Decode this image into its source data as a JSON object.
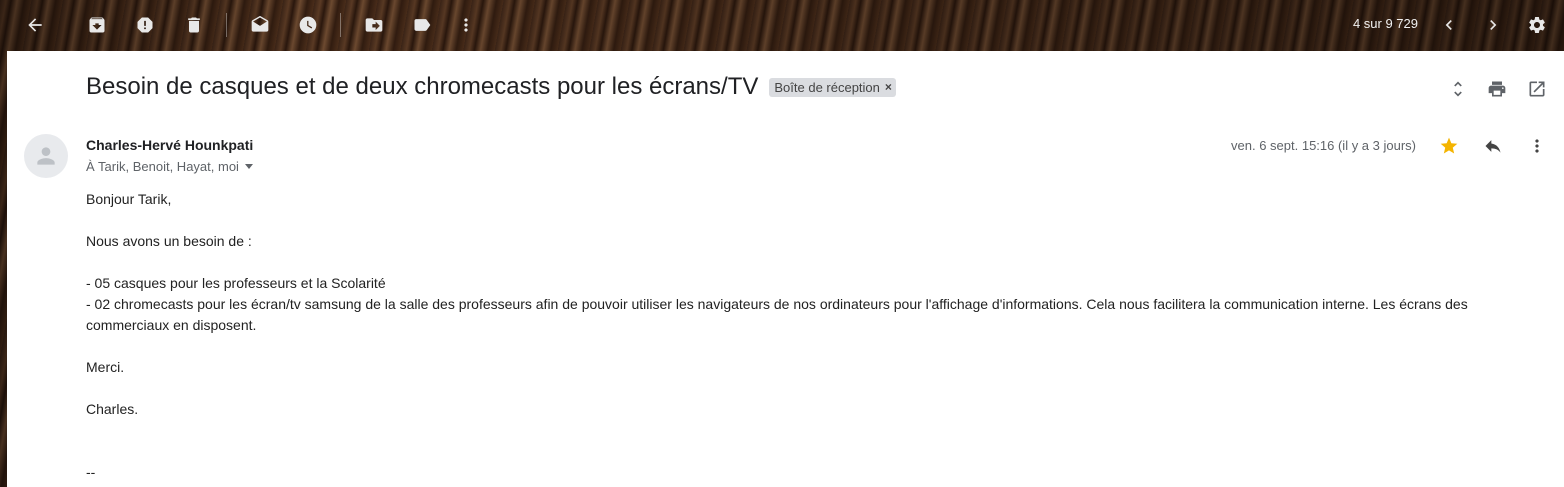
{
  "toolbar": {
    "buttons": [
      {
        "name": "back-icon"
      },
      {
        "name": "archive-icon"
      },
      {
        "name": "report-spam-icon"
      },
      {
        "name": "delete-icon"
      },
      {
        "name": "mark-unread-icon"
      },
      {
        "name": "snooze-icon"
      },
      {
        "name": "move-to-icon"
      },
      {
        "name": "label-icon"
      },
      {
        "name": "more-vert-icon"
      }
    ],
    "counter": "4 sur 9 729"
  },
  "email": {
    "subject": "Besoin de casques et de deux chromecasts pour les écrans/TV",
    "label_chip": "Boîte de réception",
    "label_chip_close": "×",
    "sender": "Charles-Hervé Hounkpati",
    "recipients": "À Tarik, Benoit, Hayat, moi",
    "date": "ven. 6 sept. 15:16 (il y a 3 jours)",
    "starred": true,
    "body": {
      "greeting": "Bonjour Tarik,",
      "line1": "Nous avons un besoin de :",
      "item1": "- 05 casques pour les professeurs et la Scolarité",
      "item2": "- 02 chromecasts pour les écran/tv samsung de la salle des professeurs afin de pouvoir utiliser les navigateurs de nos ordinateurs pour l'affichage d'informations.  Cela nous facilitera la communication interne. Les écrans des commerciaux en disposent.",
      "thanks": "Merci.",
      "signoff": "Charles.",
      "sig_sep": "--"
    }
  },
  "colors": {
    "star": "#f4b400",
    "chip_bg": "#dadce0",
    "panel_bg": "#ffffff"
  }
}
